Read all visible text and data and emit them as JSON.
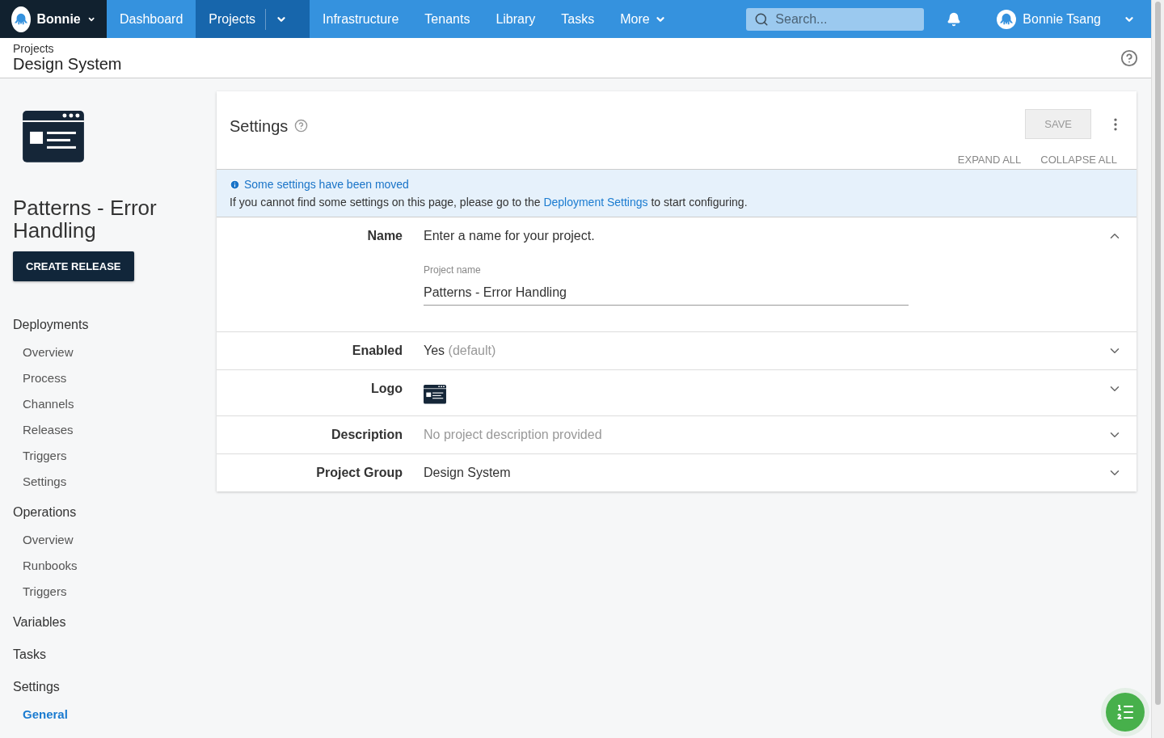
{
  "nav": {
    "space": "Bonnie",
    "items": [
      {
        "label": "Dashboard",
        "selected": false,
        "dropdown": false
      },
      {
        "label": "Projects",
        "selected": true,
        "dropdown": true
      },
      {
        "label": "Infrastructure",
        "selected": false,
        "dropdown": false
      },
      {
        "label": "Tenants",
        "selected": false,
        "dropdown": false
      },
      {
        "label": "Library",
        "selected": false,
        "dropdown": false
      },
      {
        "label": "Tasks",
        "selected": false,
        "dropdown": false
      },
      {
        "label": "More",
        "selected": false,
        "dropdown": true
      }
    ],
    "search": {
      "placeholder": "Search..."
    },
    "user": "Bonnie Tsang"
  },
  "header": {
    "breadcrumb": "Projects",
    "title": "Design System"
  },
  "sidebar": {
    "project_name": "Patterns - Error Handling",
    "create_release": "CREATE RELEASE",
    "sections": [
      {
        "label": "Deployments",
        "selected": false,
        "children": [
          {
            "label": "Overview",
            "selected": false
          },
          {
            "label": "Process",
            "selected": false
          },
          {
            "label": "Channels",
            "selected": false
          },
          {
            "label": "Releases",
            "selected": false
          },
          {
            "label": "Triggers",
            "selected": false
          },
          {
            "label": "Settings",
            "selected": false
          }
        ]
      },
      {
        "label": "Operations",
        "selected": false,
        "children": [
          {
            "label": "Overview",
            "selected": false
          },
          {
            "label": "Runbooks",
            "selected": false
          },
          {
            "label": "Triggers",
            "selected": false
          }
        ]
      },
      {
        "label": "Variables",
        "selected": false
      },
      {
        "label": "Tasks",
        "selected": false
      },
      {
        "label": "Settings",
        "selected": false,
        "children": [
          {
            "label": "General",
            "selected": true
          }
        ]
      }
    ]
  },
  "settings": {
    "title": "Settings",
    "save": "SAVE",
    "expand_all": "EXPAND ALL",
    "collapse_all": "COLLAPSE ALL",
    "notice": {
      "title": "Some settings have been moved",
      "before": "If you cannot find some settings on this page, please go to the",
      "link": "Deployment Settings",
      "after": "to start configuring."
    },
    "rows": [
      {
        "kind": "input",
        "label": "Name",
        "expanded": true,
        "description": "Enter a name for your project.",
        "field_label": "Project name",
        "value": "Patterns - Error Handling"
      },
      {
        "kind": "text",
        "label": "Enabled",
        "expanded": false,
        "value": "Yes",
        "hint": "(default)"
      },
      {
        "kind": "logo",
        "label": "Logo",
        "expanded": false
      },
      {
        "kind": "muted",
        "label": "Description",
        "expanded": false,
        "value": "No project description provided"
      },
      {
        "kind": "text",
        "label": "Project Group",
        "expanded": false,
        "value": "Design System"
      }
    ]
  }
}
